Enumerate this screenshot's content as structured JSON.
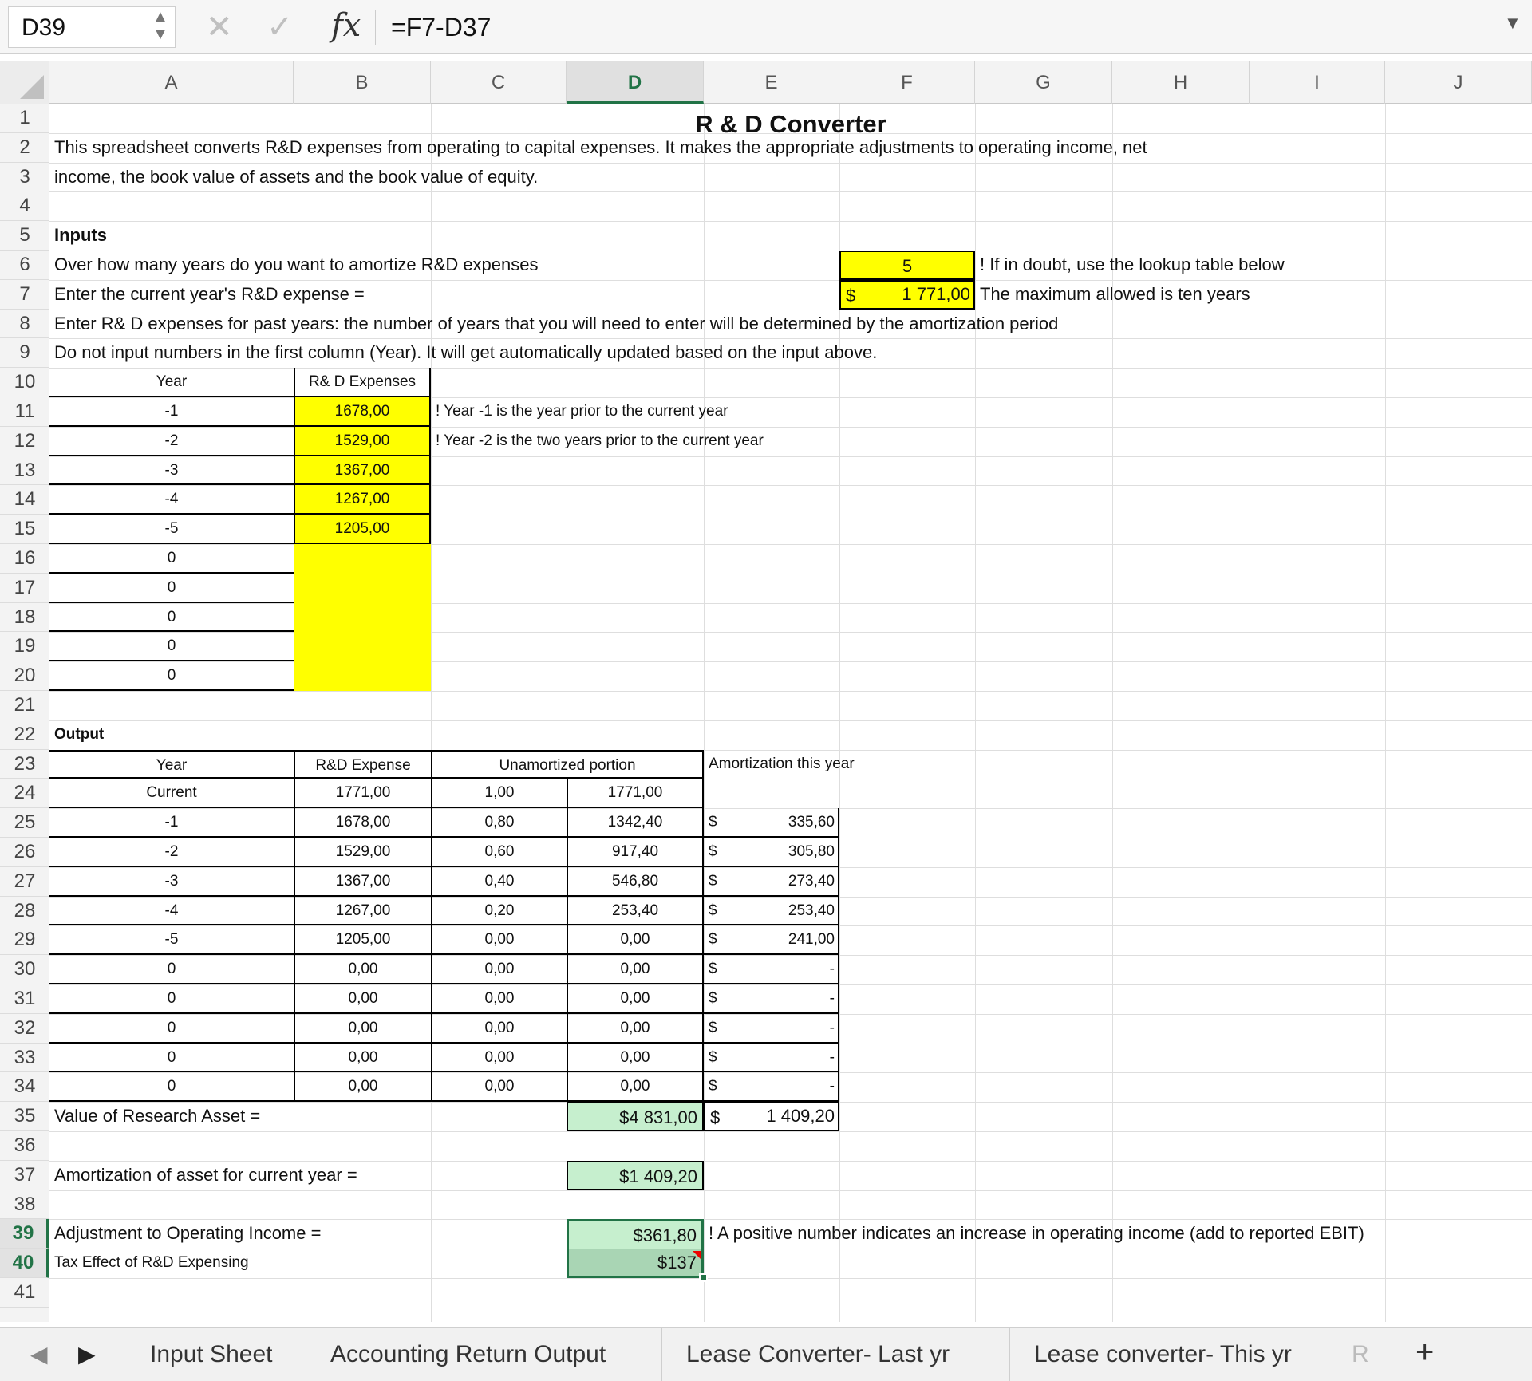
{
  "formula_bar": {
    "cell_ref": "D39",
    "formula": "=F7-D37",
    "cancel_icon": "✕",
    "confirm_icon": "✓",
    "fx_label": "fx"
  },
  "columns": [
    "A",
    "B",
    "C",
    "D",
    "E",
    "F",
    "G",
    "H",
    "I",
    "J"
  ],
  "active_column": "D",
  "active_rows": [
    39,
    40
  ],
  "sheet": {
    "title": "R & D Converter",
    "intro_line1": "This spreadsheet converts R&D expenses from operating to capital expenses. It makes the appropriate adjustments to operating income, net",
    "intro_line2": "income, the book value of assets and the book value of equity.",
    "inputs_heading": "Inputs",
    "q_years": "Over how many years do you want to amortize R&D expenses",
    "years_value": "5",
    "years_note": "! If in doubt, use the lookup table below",
    "q_current": "Enter the current year's R&D expense =",
    "current_currency": "$",
    "current_value": "1 771,00",
    "current_note": "The maximum allowed is ten years",
    "instr_line8": "Enter R& D expenses for past years: the number of years that you will need to enter will be determined by the amortization period",
    "instr_line9": "Do not input numbers in the first column (Year). It will get automatically updated  based on the input above.",
    "input_header_year": "Year",
    "input_header_exp": "R& D Expenses",
    "input_rows": [
      {
        "year": "-1",
        "exp": "1678,00"
      },
      {
        "year": "-2",
        "exp": "1529,00"
      },
      {
        "year": "-3",
        "exp": "1367,00"
      },
      {
        "year": "-4",
        "exp": "1267,00"
      },
      {
        "year": "-5",
        "exp": "1205,00"
      },
      {
        "year": "0",
        "exp": ""
      },
      {
        "year": "0",
        "exp": ""
      },
      {
        "year": "0",
        "exp": ""
      },
      {
        "year": "0",
        "exp": ""
      },
      {
        "year": "0",
        "exp": ""
      }
    ],
    "note_year1": "! Year -1 is the year prior to the current year",
    "note_year2": "! Year -2 is the two years prior to the current year",
    "output_heading": "Output",
    "out_header_year": "Year",
    "out_header_exp": "R&D Expense",
    "out_header_unam": "Unamortized portion",
    "out_header_amort": "Amortization this year",
    "output_rows": [
      {
        "year": "Current",
        "exp": "1771,00",
        "frac": "1,00",
        "unam": "1771,00",
        "cur": "",
        "amort": ""
      },
      {
        "year": "-1",
        "exp": "1678,00",
        "frac": "0,80",
        "unam": "1342,40",
        "cur": "$",
        "amort": "335,60"
      },
      {
        "year": "-2",
        "exp": "1529,00",
        "frac": "0,60",
        "unam": "917,40",
        "cur": "$",
        "amort": "305,80"
      },
      {
        "year": "-3",
        "exp": "1367,00",
        "frac": "0,40",
        "unam": "546,80",
        "cur": "$",
        "amort": "273,40"
      },
      {
        "year": "-4",
        "exp": "1267,00",
        "frac": "0,20",
        "unam": "253,40",
        "cur": "$",
        "amort": "253,40"
      },
      {
        "year": "-5",
        "exp": "1205,00",
        "frac": "0,00",
        "unam": "0,00",
        "cur": "$",
        "amort": "241,00"
      },
      {
        "year": "0",
        "exp": "0,00",
        "frac": "0,00",
        "unam": "0,00",
        "cur": "$",
        "amort": "-"
      },
      {
        "year": "0",
        "exp": "0,00",
        "frac": "0,00",
        "unam": "0,00",
        "cur": "$",
        "amort": "-"
      },
      {
        "year": "0",
        "exp": "0,00",
        "frac": "0,00",
        "unam": "0,00",
        "cur": "$",
        "amort": "-"
      },
      {
        "year": "0",
        "exp": "0,00",
        "frac": "0,00",
        "unam": "0,00",
        "cur": "$",
        "amort": "-"
      },
      {
        "year": "0",
        "exp": "0,00",
        "frac": "0,00",
        "unam": "0,00",
        "cur": "$",
        "amort": "-"
      }
    ],
    "value_asset_label": "Value of Research Asset =",
    "value_asset": "$4 831,00",
    "value_amort_cur": "$",
    "value_amort_total": "1 409,20",
    "amort_label": "Amortization of asset for current year =",
    "amort_value": "$1 409,20",
    "adj_label": "Adjustment to Operating Income =",
    "adj_value": "$361,80",
    "adj_note": "! A positive number indicates an increase in operating income (add to reported EBIT)",
    "tax_label": "Tax Effect of R&D Expensing",
    "tax_value": "$137"
  },
  "tabs": [
    "Input Sheet",
    "Accounting Return Output",
    "Lease Converter- Last yr",
    "Lease converter- This yr",
    "R"
  ],
  "tab_icons": {
    "prev": "◀",
    "next": "▶",
    "add": "+"
  },
  "colors": {
    "input_yellow": "#ffff00",
    "output_green": "#c6efce",
    "excel_green": "#217346"
  }
}
